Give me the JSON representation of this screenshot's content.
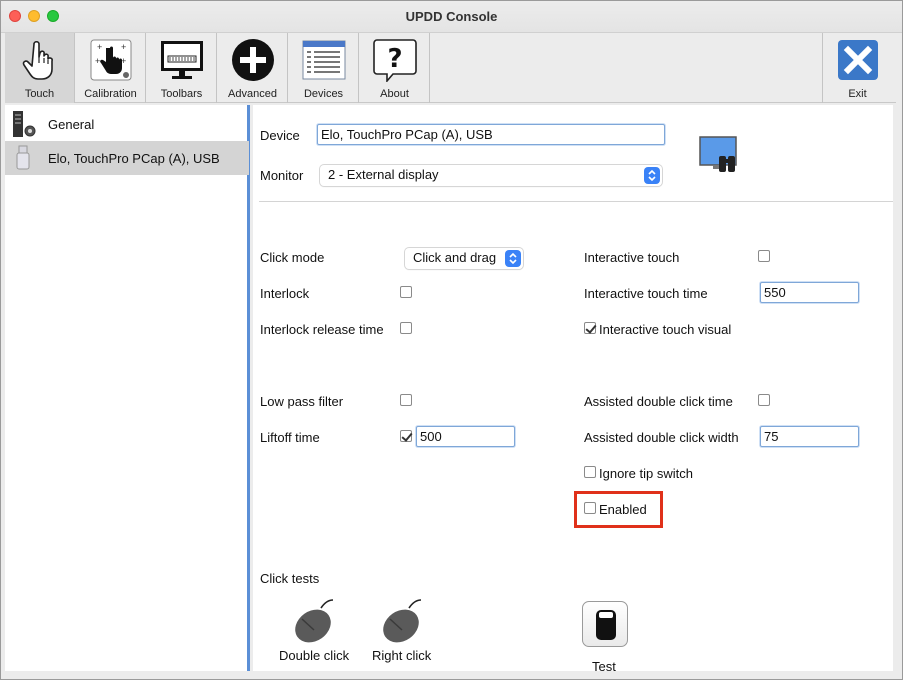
{
  "window": {
    "title": "UPDD Console"
  },
  "toolbar": {
    "items": [
      {
        "label": "Touch",
        "icon": "hand-touch-icon"
      },
      {
        "label": "Calibration",
        "icon": "calibration-icon"
      },
      {
        "label": "Toolbars",
        "icon": "toolbars-icon"
      },
      {
        "label": "Advanced",
        "icon": "plus-circle-icon"
      },
      {
        "label": "Devices",
        "icon": "devices-icon"
      },
      {
        "label": "About",
        "icon": "question-bubble-icon"
      }
    ],
    "exit_label": "Exit",
    "active": "Touch"
  },
  "sidebar": {
    "items": [
      {
        "label": "General",
        "icon": "general-settings-icon",
        "selected": false
      },
      {
        "label": "Elo, TouchPro PCap (A), USB",
        "icon": "usb-icon",
        "selected": true
      }
    ]
  },
  "device": {
    "label": "Device",
    "value": "Elo, TouchPro PCap (A), USB"
  },
  "monitor": {
    "label": "Monitor",
    "value": "2 - External display",
    "icon": "identify-monitor-icon"
  },
  "settings": {
    "click_mode": {
      "label": "Click mode",
      "value": "Click and drag"
    },
    "interlock": {
      "label": "Interlock",
      "checked": false
    },
    "interlock_release_time": {
      "label": "Interlock release time",
      "checked": false
    },
    "low_pass_filter": {
      "label": "Low pass filter",
      "checked": false
    },
    "liftoff_time": {
      "label": "Liftoff time",
      "checked": true,
      "value": "500"
    },
    "interactive_touch": {
      "label": "Interactive touch",
      "checked": false
    },
    "interactive_touch_time": {
      "label": "Interactive touch time",
      "value": "550"
    },
    "interactive_touch_visual": {
      "label": "Interactive touch visual",
      "checked": true
    },
    "assisted_double_click_time": {
      "label": "Assisted double click time",
      "checked": false
    },
    "assisted_double_click_width": {
      "label": "Assisted double click width",
      "value": "75"
    },
    "ignore_tip_switch": {
      "label": "Ignore tip switch",
      "checked": false
    },
    "enabled": {
      "label": "Enabled",
      "checked": false
    }
  },
  "click_tests": {
    "title": "Click tests",
    "double_click": "Double click",
    "right_click": "Right click",
    "test": "Test"
  },
  "colors": {
    "accent": "#3a82f7",
    "highlight": "#e0311a",
    "sidebar_border": "#5b8fd6"
  }
}
